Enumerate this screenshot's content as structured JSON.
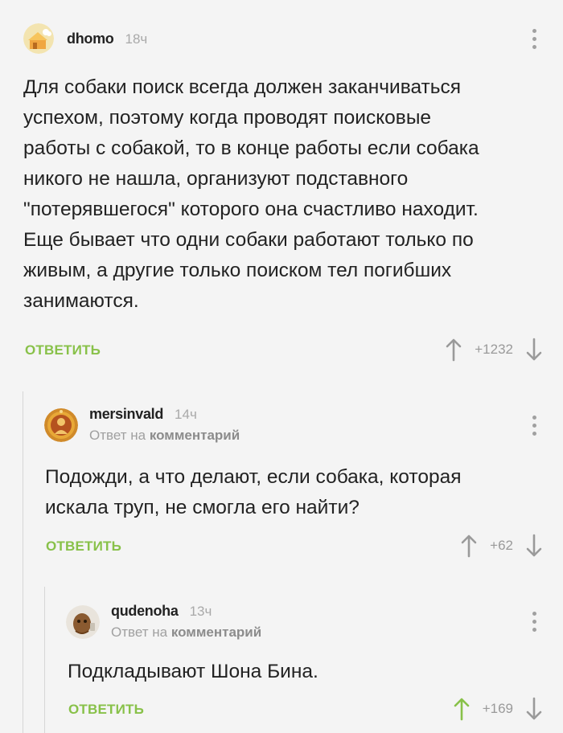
{
  "comments": [
    {
      "username": "dhomo",
      "time": "18ч",
      "reply_to": null,
      "text_lines": [
        "Для собаки поиск всегда должен заканчиваться",
        "успехом, поэтому когда проводят поисковые",
        "работы с собакой, то в конце работы если собака",
        "никого не нашла, организуют подставного",
        "\"потерявшегося\" которого она счастливо находит.",
        "Еще бывает что одни собаки работают только по",
        "живым, а другие только поиском тел погибших",
        "занимаются."
      ],
      "reply_label": "ОТВЕТИТЬ",
      "rating": "+1232",
      "upvoted": false
    },
    {
      "username": "mersinvald",
      "time": "14ч",
      "reply_to": {
        "prefix": "Ответ на",
        "target": "комментарий"
      },
      "text_lines": [
        "Подожди, а что делают, если собака, которая",
        "искала труп, не смогла его найти?"
      ],
      "reply_label": "ОТВЕТИТЬ",
      "rating": "+62",
      "upvoted": false
    },
    {
      "username": "qudenoha",
      "time": "13ч",
      "reply_to": {
        "prefix": "Ответ на",
        "target": "комментарий"
      },
      "text_lines": [
        "Подкладывают Шона Бина."
      ],
      "reply_label": "ОТВЕТИТЬ",
      "rating": "+169",
      "upvoted": true
    }
  ],
  "colors": {
    "accent": "#88c149",
    "background": "#f4f4f4",
    "muted": "#a0a0a0"
  }
}
